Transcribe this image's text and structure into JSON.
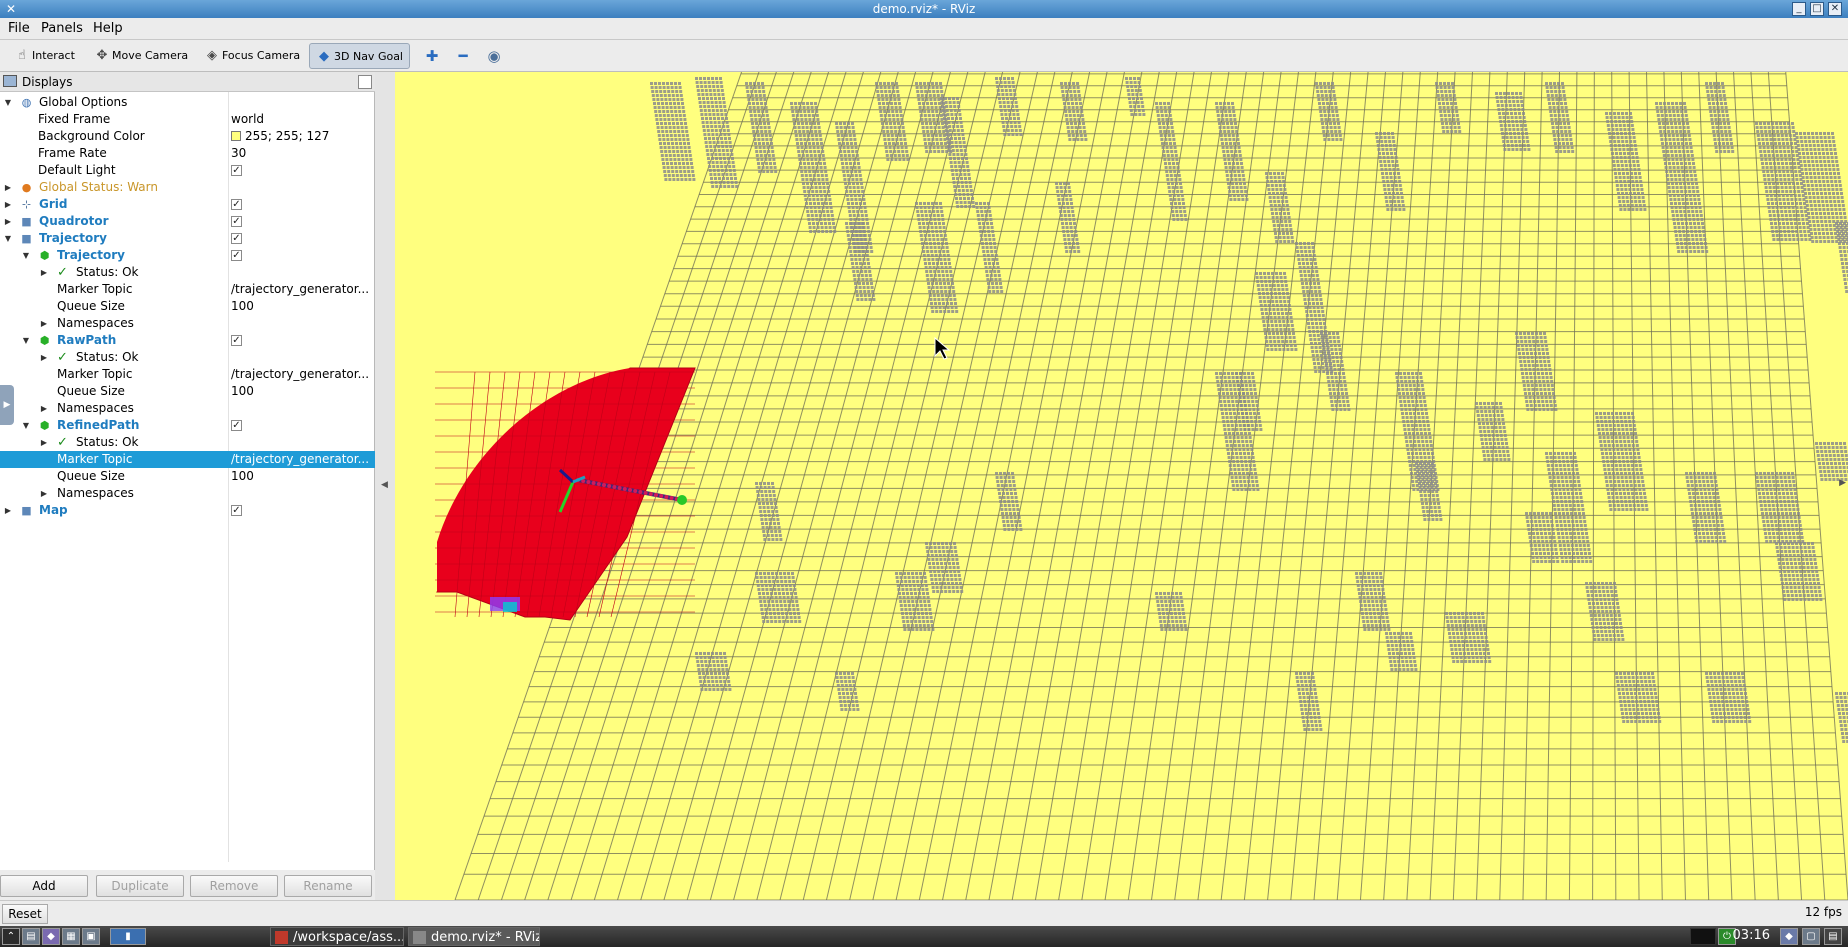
{
  "window": {
    "title": "demo.rviz* - RViz"
  },
  "menu": [
    "File",
    "Panels",
    "Help"
  ],
  "toolbar": {
    "tools": [
      {
        "label": "Interact",
        "icon": "hand-pointer-icon",
        "active": false
      },
      {
        "label": "Move Camera",
        "icon": "move-camera-icon",
        "active": false
      },
      {
        "label": "Focus Camera",
        "icon": "focus-camera-icon",
        "active": false
      },
      {
        "label": "3D Nav Goal",
        "icon": "nav-goal-icon",
        "active": true
      }
    ],
    "extra_icons": [
      "add-tool-icon",
      "remove-tool-icon",
      "camera-type-icon"
    ]
  },
  "displays": {
    "title": "Displays",
    "rows": [
      {
        "label": "Global Options",
        "value": ""
      },
      {
        "label": "Fixed Frame",
        "value": "world"
      },
      {
        "label": "Background Color",
        "value": "255; 255; 127"
      },
      {
        "label": "Frame Rate",
        "value": "30"
      },
      {
        "label": "Default Light",
        "value": ""
      },
      {
        "label": "Global Status: Warn",
        "value": ""
      },
      {
        "label": "Grid",
        "value": ""
      },
      {
        "label": "Quadrotor",
        "value": ""
      },
      {
        "label": "Trajectory",
        "value": ""
      },
      {
        "label": "Trajectory",
        "value": ""
      },
      {
        "label": "Status: Ok",
        "value": ""
      },
      {
        "label": "Marker Topic",
        "value": "/trajectory_generator..."
      },
      {
        "label": "Queue Size",
        "value": "100"
      },
      {
        "label": "Namespaces",
        "value": ""
      },
      {
        "label": "RawPath",
        "value": ""
      },
      {
        "label": "Status: Ok",
        "value": ""
      },
      {
        "label": "Marker Topic",
        "value": "/trajectory_generator..."
      },
      {
        "label": "Queue Size",
        "value": "100"
      },
      {
        "label": "Namespaces",
        "value": ""
      },
      {
        "label": "RefinedPath",
        "value": ""
      },
      {
        "label": "Status: Ok",
        "value": ""
      },
      {
        "label": "Marker Topic",
        "value": "/trajectory_generator..."
      },
      {
        "label": "Queue Size",
        "value": "100"
      },
      {
        "label": "Namespaces",
        "value": ""
      },
      {
        "label": "Map",
        "value": ""
      }
    ],
    "buttons": {
      "add": "Add",
      "duplicate": "Duplicate",
      "remove": "Remove",
      "rename": "Rename"
    }
  },
  "statusbar": {
    "reset": "Reset",
    "fps": "12 fps"
  },
  "taskbar": {
    "tasks": [
      "/workspace/ass...",
      "demo.rviz* - RViz"
    ],
    "clock": "03:16"
  },
  "colors": {
    "background": "#ffff7f",
    "grid": "#6b6b54",
    "obstacle": "#8c8c8c",
    "path": "#3a2a7a",
    "red_area": "#e8001c",
    "selection": "#1e9bd7"
  }
}
